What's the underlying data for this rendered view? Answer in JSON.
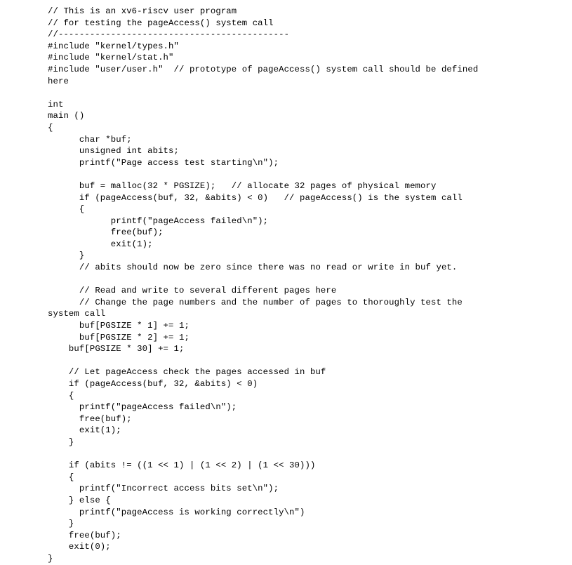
{
  "code": {
    "line01": "// This is an xv6-riscv user program",
    "line02": "// for testing the pageAccess() system call",
    "line03": "//--------------------------------------------",
    "line04": "#include \"kernel/types.h\"",
    "line05": "#include \"kernel/stat.h\"",
    "line06": "#include \"user/user.h\"  // prototype of pageAccess() system call should be defined",
    "line07": "here",
    "line08": "",
    "line09": "int",
    "line10": "main ()",
    "line11": "{",
    "line12": "      char *buf;",
    "line13": "      unsigned int abits;",
    "line14": "      printf(\"Page access test starting\\n\");",
    "line15": "",
    "line16": "      buf = malloc(32 * PGSIZE);   // allocate 32 pages of physical memory",
    "line17": "      if (pageAccess(buf, 32, &abits) < 0)   // pageAccess() is the system call",
    "line18": "      {",
    "line19": "            printf(\"pageAccess failed\\n\");",
    "line20": "            free(buf);",
    "line21": "            exit(1);",
    "line22": "      }",
    "line23": "      // abits should now be zero since there was no read or write in buf yet.",
    "line24": "",
    "line25": "      // Read and write to several different pages here",
    "line26": "      // Change the page numbers and the number of pages to thoroughly test the",
    "line27": "system call",
    "line28": "      buf[PGSIZE * 1] += 1;",
    "line29": "      buf[PGSIZE * 2] += 1;",
    "line30": "    buf[PGSIZE * 30] += 1;",
    "line31": "",
    "line32": "    // Let pageAccess check the pages accessed in buf",
    "line33": "    if (pageAccess(buf, 32, &abits) < 0)",
    "line34": "    {",
    "line35": "      printf(\"pageAccess failed\\n\");",
    "line36": "      free(buf);",
    "line37": "      exit(1);",
    "line38": "    }",
    "line39": "",
    "line40": "    if (abits != ((1 << 1) | (1 << 2) | (1 << 30)))",
    "line41": "    {",
    "line42": "      printf(\"Incorrect access bits set\\n\");",
    "line43": "    } else {",
    "line44": "      printf(\"pageAccess is working correctly\\n\")",
    "line45": "    }",
    "line46": "    free(buf);",
    "line47": "    exit(0);",
    "line48": "}"
  }
}
